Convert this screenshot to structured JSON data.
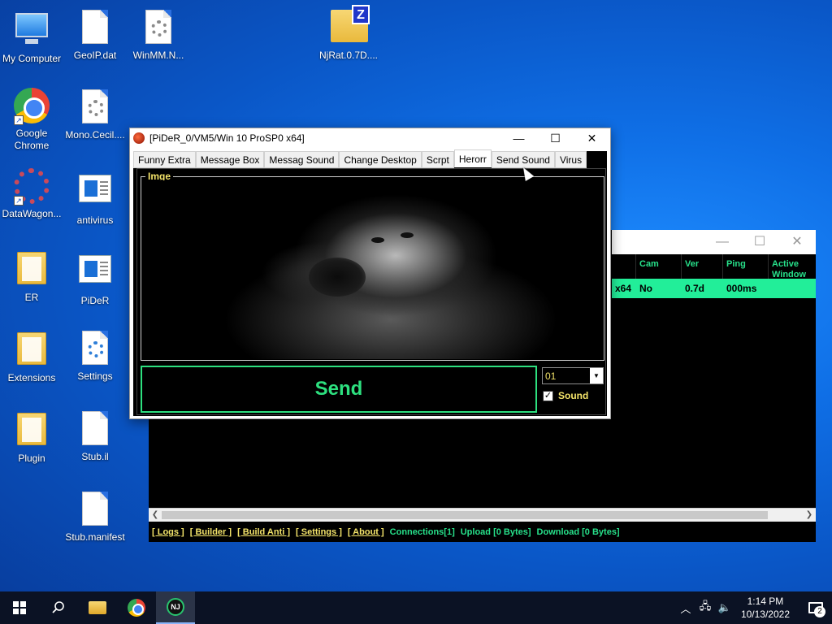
{
  "desktop": {
    "icons": [
      {
        "label": "My Computer"
      },
      {
        "label": "GeoIP.dat"
      },
      {
        "label": "WinMM.N..."
      },
      {
        "label": "NjRat.0.7D...."
      },
      {
        "label": "Google Chrome"
      },
      {
        "label": "Mono.Cecil...."
      },
      {
        "label": "DataWagon..."
      },
      {
        "label": "antivirus"
      },
      {
        "label": "ER"
      },
      {
        "label": "PiDeR"
      },
      {
        "label": "Extensions"
      },
      {
        "label": "Settings"
      },
      {
        "label": "Plugin"
      },
      {
        "label": "Stub.il"
      },
      {
        "label": "Stub.manifest"
      }
    ]
  },
  "pider_window": {
    "title": "[PiDeR_0/VM5/Win 10 ProSP0 x64]",
    "minimize": "—",
    "maximize": "☐",
    "close": "✕",
    "tabs": [
      {
        "label": "Funny Extra"
      },
      {
        "label": "Message Box"
      },
      {
        "label": "Messag Sound"
      },
      {
        "label": "Change Desktop"
      },
      {
        "label": "Scrpt"
      },
      {
        "label": "Herorr"
      },
      {
        "label": "Send Sound"
      },
      {
        "label": "Virus"
      }
    ],
    "active_tab": "Herorr",
    "group_label": "Imge",
    "send_label": "Send",
    "combo_value": "01",
    "sound_label": "Sound",
    "sound_checked": true
  },
  "njrat_window": {
    "minimize": "—",
    "maximize": "☐",
    "close": "✕",
    "columns": [
      "Cam",
      "Ver",
      "Ping",
      "Active Window"
    ],
    "row": {
      "os": "x64",
      "cam": "No",
      "ver": "0.7d",
      "ping": "000ms",
      "active_window": ""
    },
    "statusbar": {
      "logs": "[ Logs ]",
      "builder": "[ Builder ]",
      "build_anti": "[ Build Anti ]",
      "settings": "[ Settings ]",
      "about": "[ About ]",
      "connections": "Connections[1]",
      "upload": "Upload [0 Bytes]",
      "download": "Download [0 Bytes]"
    }
  },
  "taskbar": {
    "time": "1:14 PM",
    "date": "10/13/2022",
    "notification_count": "2",
    "njrat_label": "NJ"
  },
  "colors": {
    "accent_green": "#2de07f",
    "row_green": "#22ee99",
    "label_yellow": "#f4e46a"
  }
}
